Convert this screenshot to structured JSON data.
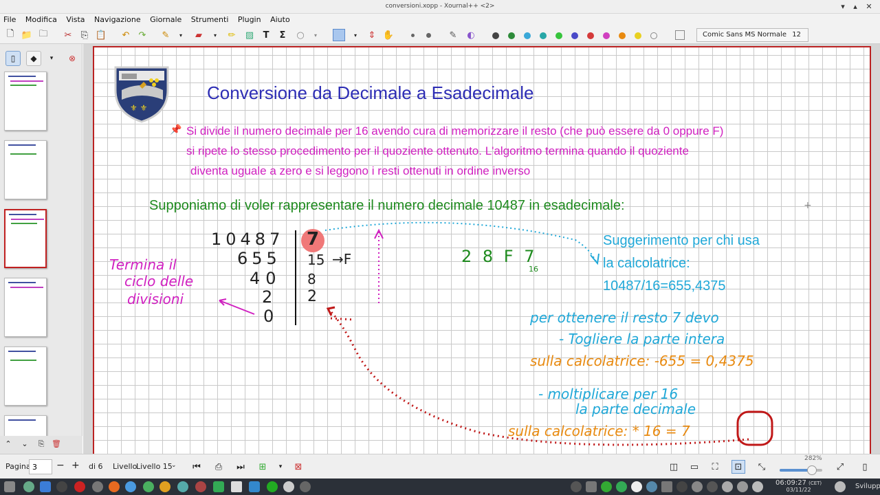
{
  "window": {
    "title": "conversioni.xopp - Xournal++ <2>"
  },
  "menu": [
    "File",
    "Modifica",
    "Vista",
    "Navigazione",
    "Giornale",
    "Strumenti",
    "Plugin",
    "Aiuto"
  ],
  "toolbar": {
    "font_name": "Comic Sans MS Normale",
    "font_size": "12"
  },
  "page_content": {
    "title": "Conversione da Decimale a Esadecimale",
    "intro_line1": "Si divide il numero decimale per 16 avendo cura di memorizzare il resto (che può essere da 0 oppure F)",
    "intro_line2": "si ripete lo stesso procedimento per il quoziente ottenuto. L'algoritmo termina quando il quoziente",
    "intro_line3": "diventa uguale a zero e si leggono i resti ottenuti in ordine inverso",
    "suppose": "Supponiamo di voler rappresentare il numero decimale 10487 in esadecimale:",
    "division_rows": [
      {
        "dividend": "10487",
        "remainder": "7"
      },
      {
        "dividend": "655",
        "remainder": "15"
      },
      {
        "dividend": "40",
        "remainder": "8"
      },
      {
        "dividend": "2",
        "remainder": "2"
      },
      {
        "dividend": "0",
        "remainder": ""
      }
    ],
    "arrow_f": "→F",
    "note_terminate": [
      "Termina il",
      "ciclo delle",
      "divisioni"
    ],
    "result": "2 8 F 7",
    "result_base": "16",
    "hint_line1": "Suggerimento per chi usa",
    "hint_line2": "la calcolatrice:",
    "hint_line3": "10487/16=655,4375",
    "explain_line1": "per ottenere il resto 7 devo",
    "explain_line2": "- Togliere la parte intera",
    "explain_line3": "sulla calcolatrice: -655 = 0,4375",
    "explain_line4": "- moltiplicare per 16",
    "explain_line5": "la parte decimale",
    "explain_line6": "sulla calcolatrice: * 16 = 7"
  },
  "status": {
    "page_label": "Pagina",
    "page_value": "3",
    "of_pages": "di 6",
    "layer_label": "Livello",
    "layer_value": "Livello 15",
    "zoom": "282%"
  },
  "taskbar": {
    "time": "06:09:27",
    "tz": "(CET)",
    "date": "03/11/22",
    "workspace": "Sviluppo"
  },
  "colors": {
    "accent": "#2d2db4",
    "magenta": "#d020c0",
    "green": "#1e8a1e",
    "cyan": "#20a8d8",
    "orange": "#e88a10",
    "red": "#c01818"
  }
}
